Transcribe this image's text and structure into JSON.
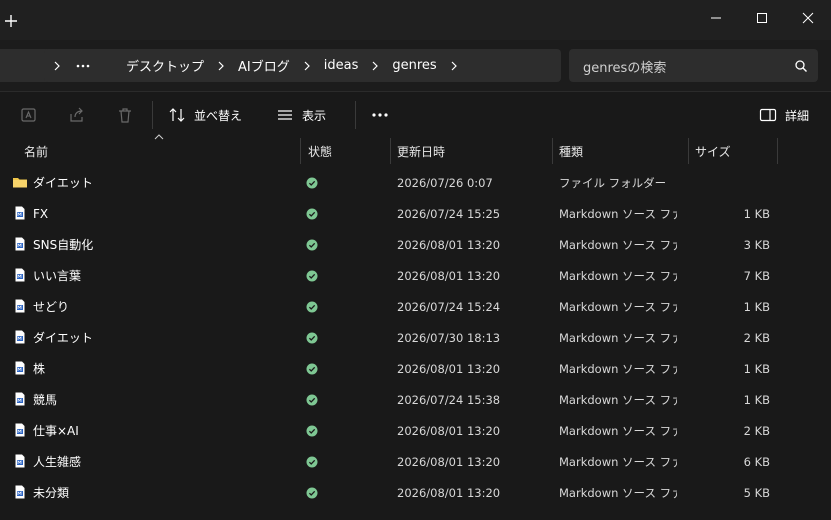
{
  "titlebar": {
    "new_tab_icon": "plus-icon",
    "controls": [
      "minimize-icon",
      "maximize-icon",
      "close-icon"
    ]
  },
  "address": {
    "breadcrumb": [
      "デスクトップ",
      "AIブログ",
      "ideas",
      "genres"
    ],
    "more_icon": "ellipsis-icon",
    "search_placeholder": "genresの検索"
  },
  "toolbar": {
    "sort_label": "並べ替え",
    "view_label": "表示",
    "details_label": "詳細"
  },
  "columns": {
    "name": "名前",
    "status": "状態",
    "date": "更新日時",
    "type": "種類",
    "size": "サイズ"
  },
  "files": [
    {
      "name": "ダイエット",
      "kind": "folder",
      "date": "2026/07/26 0:07",
      "type": "ファイル フォルダー",
      "size": ""
    },
    {
      "name": "FX",
      "kind": "file",
      "date": "2026/07/24 15:25",
      "type": "Markdown ソース ファ...",
      "size": "1 KB"
    },
    {
      "name": "SNS自動化",
      "kind": "file",
      "date": "2026/08/01 13:20",
      "type": "Markdown ソース ファ...",
      "size": "3 KB"
    },
    {
      "name": "いい言葉",
      "kind": "file",
      "date": "2026/08/01 13:20",
      "type": "Markdown ソース ファ...",
      "size": "7 KB"
    },
    {
      "name": "せどり",
      "kind": "file",
      "date": "2026/07/24 15:24",
      "type": "Markdown ソース ファ...",
      "size": "1 KB"
    },
    {
      "name": "ダイエット",
      "kind": "file",
      "date": "2026/07/30 18:13",
      "type": "Markdown ソース ファ...",
      "size": "2 KB"
    },
    {
      "name": "株",
      "kind": "file",
      "date": "2026/08/01 13:20",
      "type": "Markdown ソース ファ...",
      "size": "1 KB"
    },
    {
      "name": "競馬",
      "kind": "file",
      "date": "2026/07/24 15:38",
      "type": "Markdown ソース ファ...",
      "size": "1 KB"
    },
    {
      "name": "仕事×AI",
      "kind": "file",
      "date": "2026/08/01 13:20",
      "type": "Markdown ソース ファ...",
      "size": "2 KB"
    },
    {
      "name": "人生雑感",
      "kind": "file",
      "date": "2026/08/01 13:20",
      "type": "Markdown ソース ファ...",
      "size": "6 KB"
    },
    {
      "name": "未分類",
      "kind": "file",
      "date": "2026/08/01 13:20",
      "type": "Markdown ソース ファ...",
      "size": "5 KB"
    }
  ],
  "colors": {
    "background": "#191919",
    "status_ok": "#7ec793",
    "folder": "#f0c64a"
  }
}
